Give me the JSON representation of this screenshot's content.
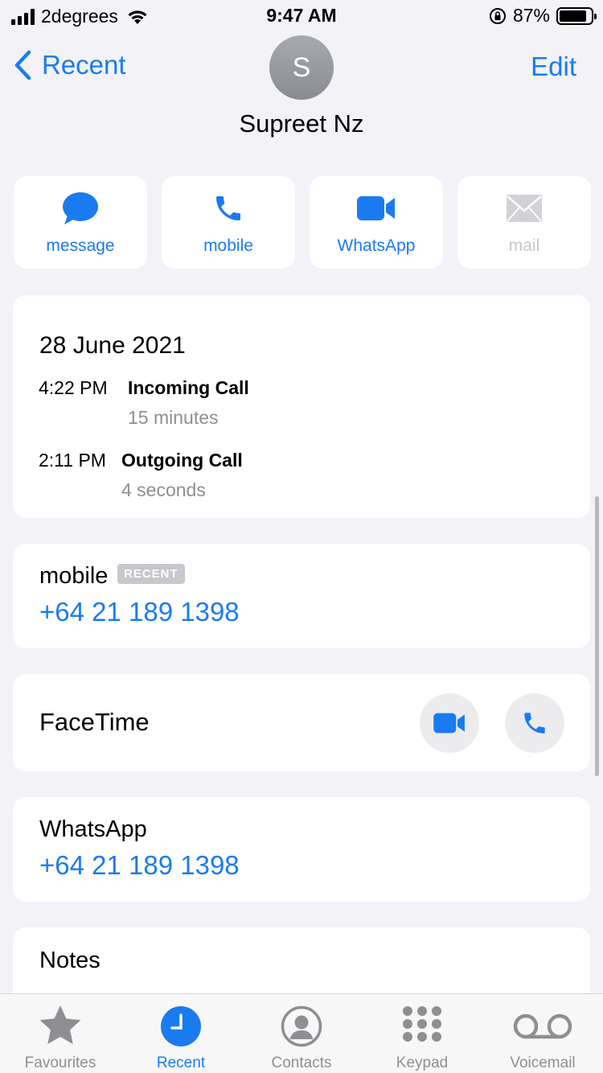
{
  "status": {
    "carrier": "2degrees",
    "time": "9:47 AM",
    "battery": "87%",
    "battery_level": 0.87
  },
  "nav": {
    "back_label": "Recent",
    "edit_label": "Edit"
  },
  "contact": {
    "initial": "S",
    "name": "Supreet Nz"
  },
  "actions": [
    {
      "label": "message",
      "icon": "message-bubble-icon",
      "enabled": true
    },
    {
      "label": "mobile",
      "icon": "phone-icon",
      "enabled": true
    },
    {
      "label": "WhatsApp",
      "icon": "video-camera-icon",
      "enabled": true
    },
    {
      "label": "mail",
      "icon": "envelope-icon",
      "enabled": false
    }
  ],
  "history": {
    "date": "28 June 2021",
    "calls": [
      {
        "time": "4:22 PM",
        "type": "Incoming Call",
        "duration": "15 minutes"
      },
      {
        "time": "2:11 PM",
        "type": "Outgoing Call",
        "duration": "4 seconds"
      }
    ]
  },
  "mobile": {
    "label": "mobile",
    "badge": "RECENT",
    "number": "+64 21 189 1398"
  },
  "facetime": {
    "label": "FaceTime"
  },
  "whatsapp": {
    "label": "WhatsApp",
    "number": "+64 21 189 1398"
  },
  "notes": {
    "label": "Notes"
  },
  "tabs": [
    {
      "label": "Favourites",
      "icon": "star-icon",
      "active": false
    },
    {
      "label": "Recent",
      "icon": "clock-icon",
      "active": true
    },
    {
      "label": "Contacts",
      "icon": "person-circle-icon",
      "active": false
    },
    {
      "label": "Keypad",
      "icon": "keypad-icon",
      "active": false
    },
    {
      "label": "Voicemail",
      "icon": "voicemail-icon",
      "active": false
    }
  ],
  "colors": {
    "accent": "#1a7bf0",
    "background": "#f2f2f7",
    "secondary_text": "#8e8e93"
  }
}
